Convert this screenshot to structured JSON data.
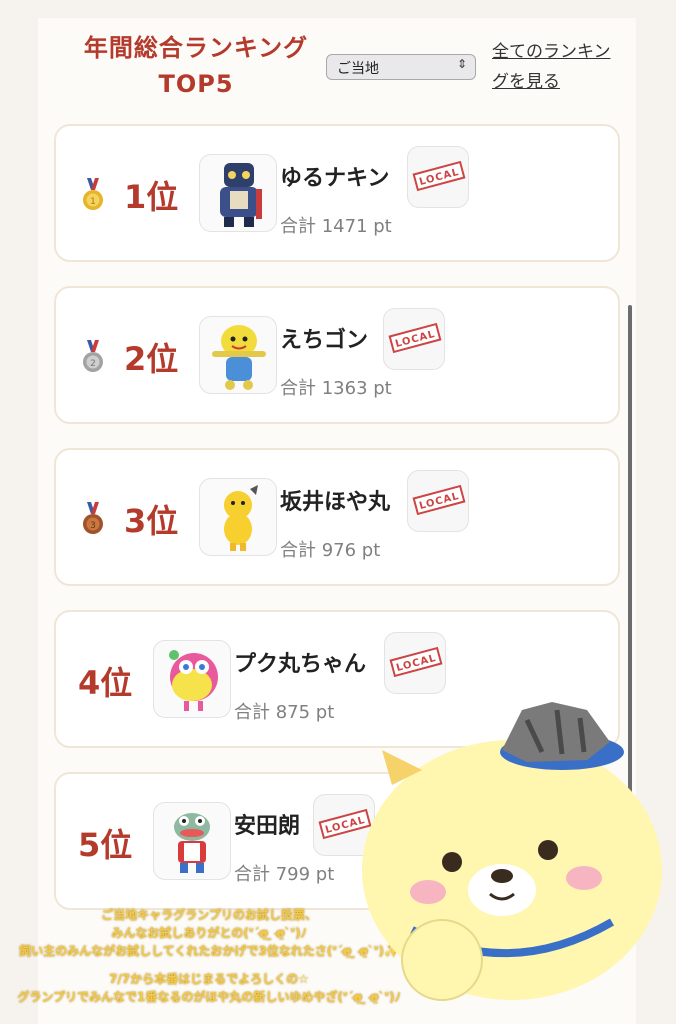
{
  "header": {
    "title_line1": "年間総合ランキング",
    "title_line2": "TOP5",
    "select_value": "ご当地",
    "all_link": "全てのランキングを見る"
  },
  "rankings": [
    {
      "rank": "1位",
      "name": "ゆるナキン",
      "points": "合計 1471 pt",
      "medal": "gold-medal",
      "badge": "LOCAL"
    },
    {
      "rank": "2位",
      "name": "えちゴン",
      "points": "合計 1363 pt",
      "medal": "silver-medal",
      "badge": "LOCAL"
    },
    {
      "rank": "3位",
      "name": "坂井ほや丸",
      "points": "合計 976 pt",
      "medal": "bronze-medal",
      "badge": "LOCAL"
    },
    {
      "rank": "4位",
      "name": "プク丸ちゃん",
      "points": "合計 875 pt",
      "medal": "",
      "badge": "LOCAL"
    },
    {
      "rank": "5位",
      "name": "安田朗",
      "points": "合計 799 pt",
      "medal": "",
      "badge": "LOCAL"
    }
  ],
  "caption": {
    "line1": "ご当地キャラグランプリのお試し投票、",
    "line2": "みんなお試しありがとの(ᐡˊo̴̶̷̤ ̫ o̴̶̷̤ˋᐡ)ﾉ",
    "line3": "飼い主のみんながお試ししてくれたおかげで3位なれたさ(ᐡˊo̴̶̷̤ ̫ o̴̶̷̤ˋᐡ)✨",
    "line4": "7/7から本番はじまるでよろしくの☆",
    "line5": "グランプリでみんなで1番なるのがほや丸の新しいゆめやざ(ᐡˊo̴̶̷̤ ̫ o̴̶̷̤ˋᐡ)ﾉ"
  },
  "colors": {
    "accent": "#b43a2c",
    "card_border": "#f1e6d6",
    "points": "#808080"
  }
}
